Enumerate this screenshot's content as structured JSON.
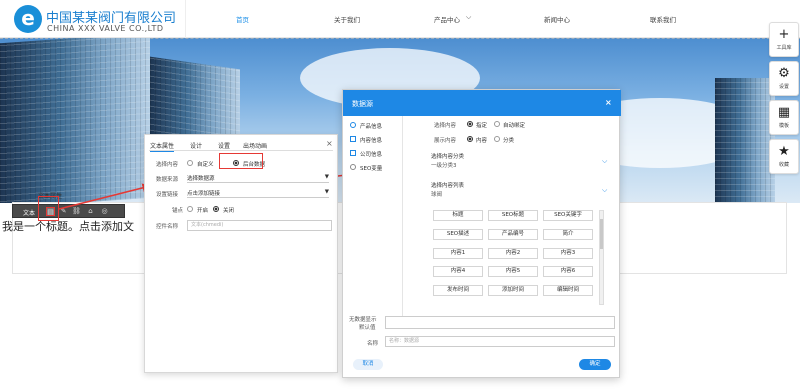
{
  "header": {
    "logo_letter": "e",
    "company_cn": "中国某某阀门有限公司",
    "company_en": "CHINA XXX VALVE CO.,LTD",
    "nav": [
      "首页",
      "关于我们",
      "产品中心",
      "新闻中心",
      "联系我们"
    ],
    "nav_dropdown_icon": "chevron-down"
  },
  "page": {
    "headline": "我是一个标题。点击添加文",
    "text_attr_label": "文本属性",
    "toolbar": {
      "label": "文本",
      "icons": [
        "datasource-icon",
        "edit-icon",
        "link-icon",
        "home-icon",
        "target-icon"
      ]
    }
  },
  "side_tools": [
    {
      "icon": "plus-icon",
      "glyph": "+",
      "label": "工具库"
    },
    {
      "icon": "gear-icon",
      "glyph": "⚙",
      "label": "设置"
    },
    {
      "icon": "template-icon",
      "glyph": "▦",
      "label": "模板"
    },
    {
      "icon": "star-icon",
      "glyph": "★",
      "label": "收藏"
    }
  ],
  "text_dialog": {
    "tabs": [
      "文本属性",
      "设计",
      "设置",
      "出场动画"
    ],
    "close": "×",
    "select_content_label": "选择内容",
    "opt_custom": "自定义",
    "opt_backend": "后台数据",
    "data_source_label": "数据来源",
    "data_source_value": "选择数据源",
    "link_label": "设置链接",
    "link_value": "点击添加链接",
    "anchor_label": "锚点",
    "anchor_on": "开启",
    "anchor_off": "关闭",
    "control_name_label": "控件名称",
    "control_name_placeholder": "文本(chmedi)"
  },
  "data_dialog": {
    "title": "数据源",
    "close": "×",
    "sources": [
      "产品信息",
      "内容信息",
      "公司信息",
      "SEO变量"
    ],
    "select_content_label": "选择内容",
    "opt_specified": "指定",
    "opt_auto": "自动绑定",
    "display_content_label": "展示内容",
    "opt_content": "内容",
    "opt_category": "分类",
    "category_title": "选择内容分类",
    "category_value": "一级分类3",
    "list_title": "选择内容列表",
    "list_value": "球阀",
    "fields": [
      "标题",
      "SEO标题",
      "SEO关键字",
      "SEO描述",
      "产品编号",
      "简介",
      "内容1",
      "内容2",
      "内容3",
      "内容4",
      "内容5",
      "内容6",
      "发布时间",
      "添加时间",
      "编辑时间"
    ],
    "empty_label_1": "无数据显示",
    "empty_label_2": "默认值",
    "name_label": "名称",
    "name_placeholder": "名称：数据源",
    "cancel": "取消",
    "confirm": "确定"
  },
  "colors": {
    "brand": "#1e88e5",
    "highlight": "#e53935"
  }
}
